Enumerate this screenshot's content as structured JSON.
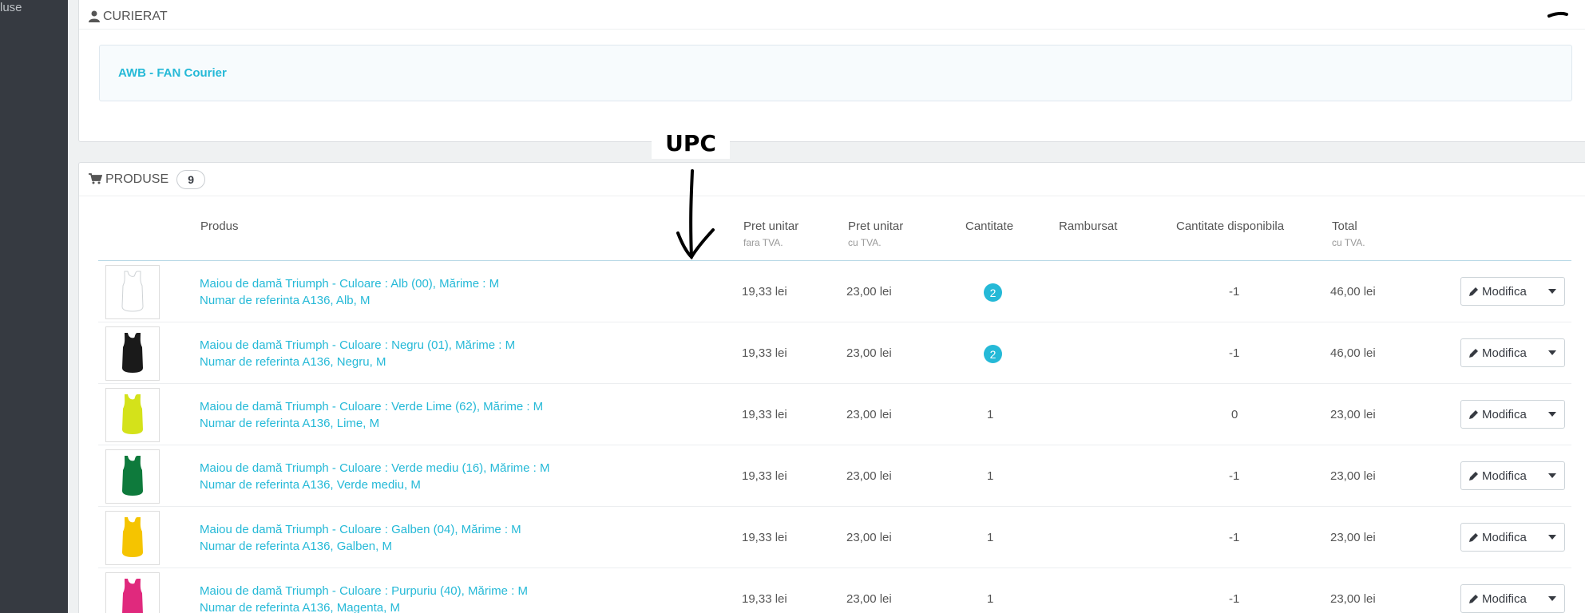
{
  "sidebar": {
    "text": "luse"
  },
  "courier_panel": {
    "title": "CURIERAT",
    "awb_link": "AWB - FAN Courier"
  },
  "products_panel": {
    "title": "PRODUSE",
    "count": "9",
    "columns": {
      "product": "Produs",
      "unit_price_ex": "Pret unitar",
      "unit_price_ex_sub": "fara TVA.",
      "unit_price_in": "Pret unitar",
      "unit_price_in_sub": "cu TVA.",
      "quantity": "Cantitate",
      "refunded": "Rambursat",
      "available": "Cantitate disponibila",
      "total": "Total",
      "total_sub": "cu TVA."
    },
    "rows": [
      {
        "name": "Maiou de damă Triumph - Culoare : Alb (00), Mărime : M",
        "ref": "Numar de referinta A136, Alb, M",
        "price_ex": "19,33 lei",
        "price_in": "23,00 lei",
        "qty": "2",
        "qty_badge": true,
        "available": "-1",
        "total": "46,00 lei",
        "color": "#ffffff"
      },
      {
        "name": "Maiou de damă Triumph - Culoare : Negru (01), Mărime : M",
        "ref": "Numar de referinta A136, Negru, M",
        "price_ex": "19,33 lei",
        "price_in": "23,00 lei",
        "qty": "2",
        "qty_badge": true,
        "available": "-1",
        "total": "46,00 lei",
        "color": "#1a1a1a"
      },
      {
        "name": "Maiou de damă Triumph - Culoare : Verde Lime (62), Mărime : M",
        "ref": "Numar de referinta A136, Lime, M",
        "price_ex": "19,33 lei",
        "price_in": "23,00 lei",
        "qty": "1",
        "qty_badge": false,
        "available": "0",
        "total": "23,00 lei",
        "color": "#d4e21a"
      },
      {
        "name": "Maiou de damă Triumph - Culoare : Verde mediu (16), Mărime : M",
        "ref": "Numar de referinta A136, Verde mediu, M",
        "price_ex": "19,33 lei",
        "price_in": "23,00 lei",
        "qty": "1",
        "qty_badge": false,
        "available": "-1",
        "total": "23,00 lei",
        "color": "#0e7a3c"
      },
      {
        "name": "Maiou de damă Triumph - Culoare : Galben (04), Mărime : M",
        "ref": "Numar de referinta A136, Galben, M",
        "price_ex": "19,33 lei",
        "price_in": "23,00 lei",
        "qty": "1",
        "qty_badge": false,
        "available": "-1",
        "total": "23,00 lei",
        "color": "#f5c400"
      },
      {
        "name": "Maiou de damă Triumph - Culoare : Purpuriu (40), Mărime : M",
        "ref": "Numar de referinta A136, Magenta, M",
        "price_ex": "19,33 lei",
        "price_in": "23,00 lei",
        "qty": "1",
        "qty_badge": false,
        "available": "-1",
        "total": "23,00 lei",
        "color": "#e0297d"
      }
    ],
    "edit_label": "Modifica"
  },
  "annotation": {
    "label": "UPC"
  },
  "icons": [
    "user-icon",
    "cart-icon",
    "pencil-icon",
    "caret-down-icon",
    "arrow-down-icon"
  ],
  "colors": {
    "accent": "#25b9d7",
    "sidebar": "#363a41"
  }
}
